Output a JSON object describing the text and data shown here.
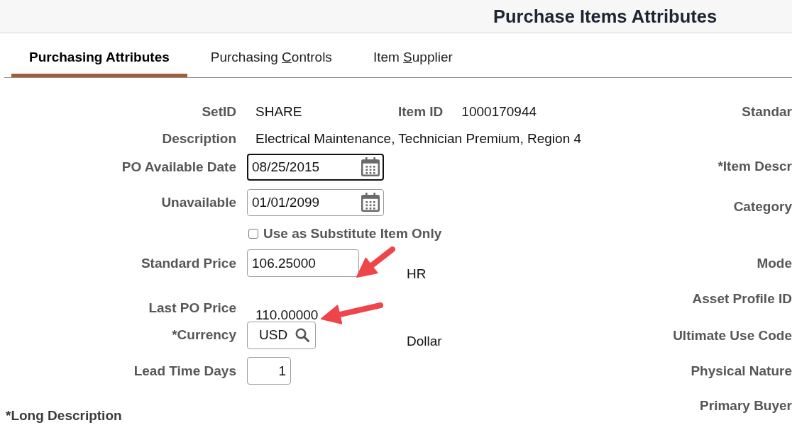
{
  "header": {
    "title": "Purchase Items Attributes"
  },
  "tabs": [
    {
      "label": "Purchasing Attributes",
      "selected": true
    },
    {
      "label": "Purchasing ",
      "access_key": "C",
      "label_end": "ontrols",
      "selected": false
    },
    {
      "label": "Item ",
      "access_key": "S",
      "label_end": "upplier",
      "selected": false
    }
  ],
  "form": {
    "rows": [
      {
        "kind": "text",
        "label": "SetID",
        "value": "SHARE",
        "side_label": "Item ID",
        "side_value": "1000170944",
        "arrow": false
      },
      {
        "kind": "text",
        "label": "Description",
        "value": "Electrical Maintenance, Technician Premium, Region 4",
        "arrow": false
      },
      {
        "kind": "date",
        "label": "PO Available Date",
        "value": "08/25/2015",
        "focused": true,
        "arrow": false
      },
      {
        "kind": "date",
        "label": "Unavailable",
        "value": "01/01/2099",
        "focused": false,
        "arrow": false
      },
      {
        "kind": "checkbox",
        "label": "Use as Substitute Item Only",
        "checked": false
      },
      {
        "kind": "input",
        "label": "Standard Price",
        "value": "106.25000",
        "unit": "HR",
        "focused": false,
        "arrow": true
      },
      {
        "kind": "text",
        "label": "Last PO Price",
        "value": "110.00000",
        "arrow": true
      },
      {
        "kind": "lookup",
        "label": "*Currency",
        "value": "USD",
        "unit": "Dollar",
        "focused": false,
        "arrow": false
      },
      {
        "kind": "number",
        "label": "Lead Time Days",
        "value": "1",
        "focused": false,
        "arrow": false
      }
    ],
    "long_description_label": "*Long Description"
  },
  "right_column": {
    "labels": [
      "Standar",
      "*Item Descr",
      "Category",
      "Mode",
      "Asset Profile ID",
      "Ultimate Use Code",
      "Physical Nature",
      "Primary Buyer"
    ]
  }
}
